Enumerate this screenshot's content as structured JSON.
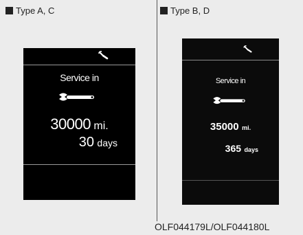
{
  "panels": {
    "left": {
      "label": "Type A, C",
      "screen": {
        "title": "Service in",
        "distance_value": "30000",
        "distance_unit": "mi.",
        "days_value": "30",
        "days_unit": "days"
      }
    },
    "right": {
      "label": "Type B, D",
      "screen": {
        "title": "Service in",
        "distance_value": "35000",
        "distance_unit": "mi.",
        "days_value": "365",
        "days_unit": "days"
      }
    }
  },
  "footer": {
    "figure_code": "OLF044179L/OLF044180L"
  },
  "icons": {
    "wrench": "wrench-icon",
    "service_wrench": "service-wrench-icon",
    "bullet": "square-bullet-icon"
  },
  "colors": {
    "background": "#ececec",
    "screen": "#000000",
    "screen_text": "#ffffff"
  }
}
